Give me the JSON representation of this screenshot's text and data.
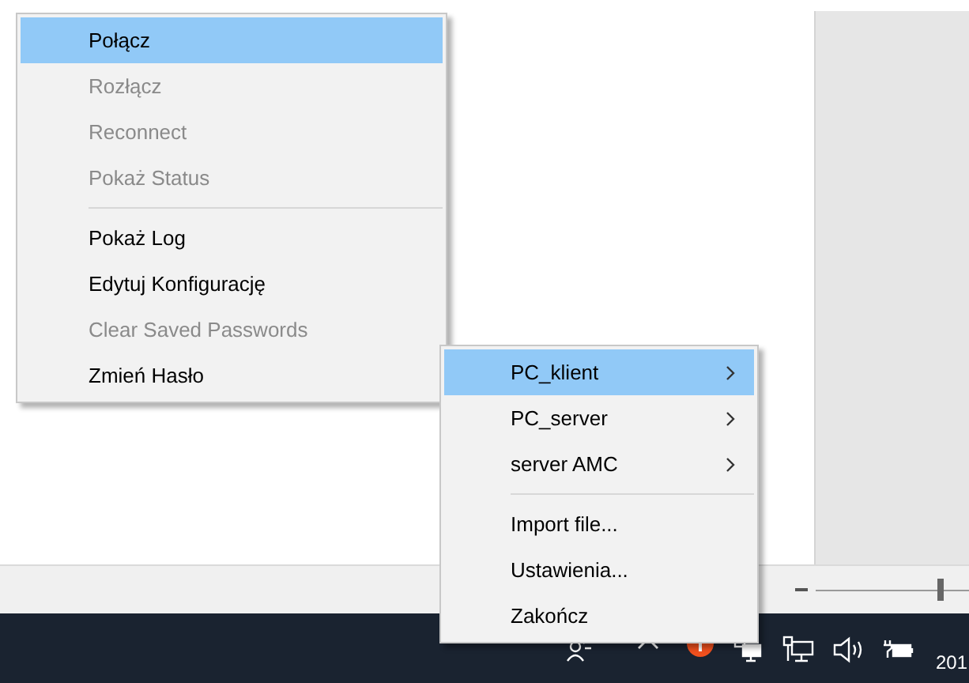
{
  "menus": [
    {
      "items": [
        {
          "kind": "item",
          "label": "Połącz",
          "disabled": false,
          "selected": true,
          "submenu": false
        },
        {
          "kind": "item",
          "label": "Rozłącz",
          "disabled": true,
          "selected": false,
          "submenu": false
        },
        {
          "kind": "item",
          "label": "Reconnect",
          "disabled": true,
          "selected": false,
          "submenu": false
        },
        {
          "kind": "item",
          "label": "Pokaż Status",
          "disabled": true,
          "selected": false,
          "submenu": false
        },
        {
          "kind": "separator"
        },
        {
          "kind": "item",
          "label": "Pokaż Log",
          "disabled": false,
          "selected": false,
          "submenu": false
        },
        {
          "kind": "item",
          "label": "Edytuj Konfigurację",
          "disabled": false,
          "selected": false,
          "submenu": false
        },
        {
          "kind": "item",
          "label": "Clear Saved Passwords",
          "disabled": true,
          "selected": false,
          "submenu": false
        },
        {
          "kind": "item",
          "label": "Zmień Hasło",
          "disabled": false,
          "selected": false,
          "submenu": false
        }
      ]
    },
    {
      "items": [
        {
          "kind": "item",
          "label": "PC_klient",
          "disabled": false,
          "selected": true,
          "submenu": true
        },
        {
          "kind": "item",
          "label": "PC_server",
          "disabled": false,
          "selected": false,
          "submenu": true
        },
        {
          "kind": "item",
          "label": "server AMC",
          "disabled": false,
          "selected": false,
          "submenu": true
        },
        {
          "kind": "separator"
        },
        {
          "kind": "item",
          "label": "Import file...",
          "disabled": false,
          "selected": false,
          "submenu": false
        },
        {
          "kind": "item",
          "label": "Ustawienia...",
          "disabled": false,
          "selected": false,
          "submenu": false
        },
        {
          "kind": "item",
          "label": "Zakończ",
          "disabled": false,
          "selected": false,
          "submenu": false
        }
      ]
    }
  ],
  "status_bar": {
    "zoom_slider": {
      "level": 0.72
    }
  },
  "taskbar": {
    "clock": {
      "date": "201"
    }
  }
}
